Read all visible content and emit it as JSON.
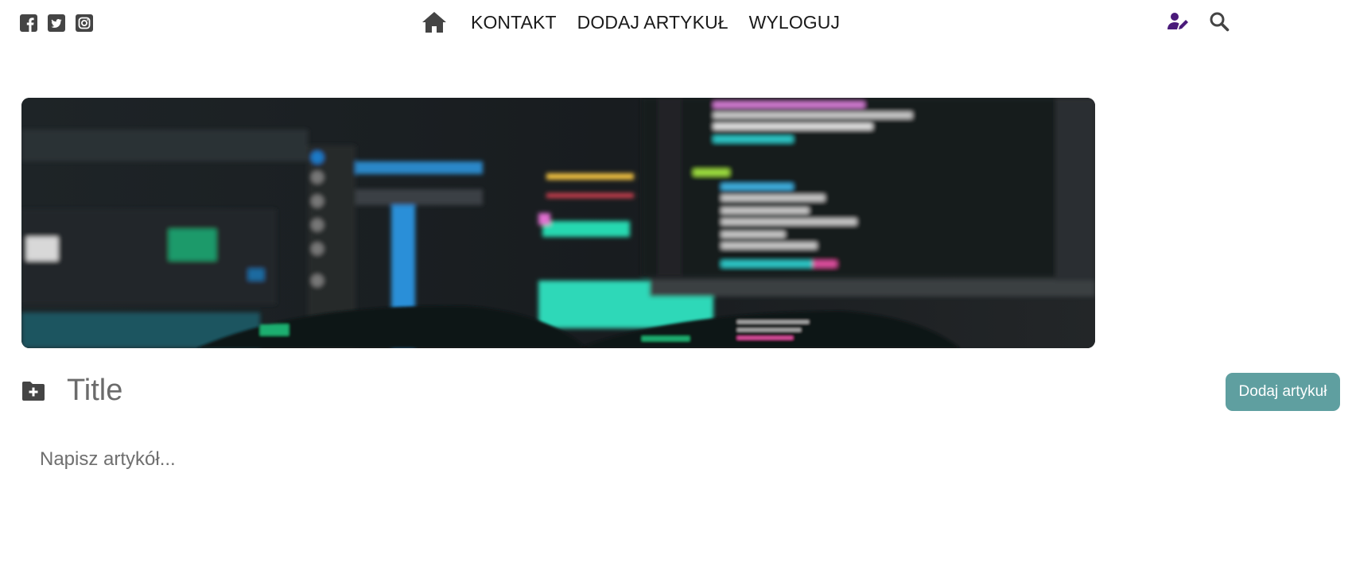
{
  "social": [
    {
      "icon": "facebook-icon"
    },
    {
      "icon": "twitter-icon"
    },
    {
      "icon": "instagram-icon"
    }
  ],
  "nav": {
    "home_icon": "home-icon",
    "links": [
      {
        "label": "KONTAKT"
      },
      {
        "label": "DODAJ ARTYKUŁ"
      },
      {
        "label": "WYLOGUJ"
      }
    ]
  },
  "header_actions": {
    "user_icon": "user-edit-icon",
    "search_icon": "search-icon"
  },
  "banner": {
    "image": "blurred-code-monitor-photo"
  },
  "editor": {
    "folder_icon": "folder-plus-icon",
    "title_placeholder": "Title",
    "title_value": "",
    "body_placeholder": "Napisz artykół...",
    "body_value": "",
    "submit_label": "Dodaj artykuł"
  },
  "colors": {
    "icon_gray": "#444444",
    "user_icon_purple": "#4a1a7a",
    "button_teal": "#5f9fa0",
    "button_text": "#ffffff",
    "banner_dark": "#1b1f22",
    "code_cyan": "#2fd8c0"
  }
}
